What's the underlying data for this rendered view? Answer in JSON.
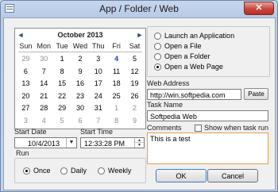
{
  "window": {
    "title": "App / Folder / Web",
    "close_glyph": "✕"
  },
  "calendar": {
    "month_title": "October 2013",
    "prev_glyph": "◄",
    "next_glyph": "►",
    "weekdays": [
      "Sun",
      "Mon",
      "Tue",
      "Wed",
      "Thu",
      "Fri",
      "Sat"
    ],
    "weeks": [
      [
        "29",
        "30",
        "1",
        "2",
        "3",
        "4",
        "5"
      ],
      [
        "6",
        "7",
        "8",
        "9",
        "10",
        "11",
        "12"
      ],
      [
        "13",
        "14",
        "15",
        "16",
        "17",
        "18",
        "19"
      ],
      [
        "20",
        "21",
        "22",
        "23",
        "24",
        "25",
        "26"
      ],
      [
        "27",
        "28",
        "29",
        "30",
        "31",
        "1",
        "2"
      ],
      [
        "3",
        "4",
        "5",
        "6",
        "7",
        "8",
        "9"
      ]
    ],
    "today": "4"
  },
  "start_date": {
    "label": "Start Date",
    "value": "10/4/2013"
  },
  "start_time": {
    "label": "Start Time",
    "value": "12:33:28 PM"
  },
  "run": {
    "label": "Run",
    "options": [
      "Once",
      "Daily",
      "Weekly"
    ],
    "selected": "Once"
  },
  "action": {
    "options": [
      "Launch an Application",
      "Open a File",
      "Open a Folder",
      "Open a Web Page"
    ],
    "selected": "Open a Web Page"
  },
  "web_address": {
    "label": "Web Address",
    "value": "http://win.softpedia.com",
    "paste_label": "Paste"
  },
  "task_name": {
    "label": "Task Name",
    "value": "Softpedia Web"
  },
  "comments": {
    "label": "Comments",
    "show_label": "Show when task run",
    "show_checked": false,
    "value": "This is a test"
  },
  "buttons": {
    "ok": "OK",
    "cancel": "Cancel"
  }
}
